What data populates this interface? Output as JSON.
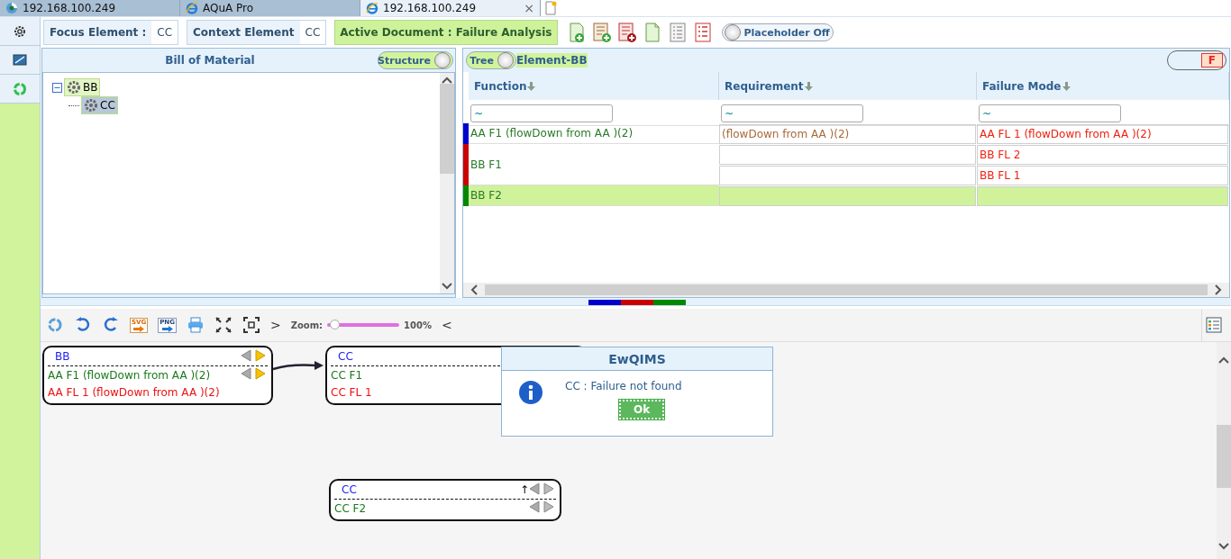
{
  "browser_tabs": [
    {
      "label": "192.168.100.249",
      "kind": "app",
      "selected": false
    },
    {
      "label": "AQuA Pro",
      "kind": "ie",
      "selected": false
    },
    {
      "label": "192.168.100.249",
      "kind": "ie",
      "selected": true,
      "close": "×"
    }
  ],
  "toolbar": {
    "focus_element": {
      "label": "Focus Element :",
      "value": "CC"
    },
    "context_element": {
      "label": "Context Element",
      "value": "CC"
    },
    "active_document": "Active Document : Failure Analysis",
    "placeholder_toggle": {
      "label": "Placeholder Off",
      "on": false
    }
  },
  "bom_panel": {
    "title": "Bill of Material",
    "structure_toggle": {
      "label": "Structure",
      "on": true
    },
    "tree": [
      {
        "label": "BB",
        "expanded": true,
        "selected": false,
        "children": [
          {
            "label": "CC",
            "selected": true
          }
        ]
      }
    ]
  },
  "analysis_panel": {
    "tree_toggle": {
      "label": "Tree",
      "on": true
    },
    "element": "Element-BB",
    "f_toggle": {
      "label": "F",
      "on": true
    },
    "table": {
      "columns": [
        "Function",
        "Requirement",
        "Failure Mode"
      ],
      "filters": [
        "~",
        "~",
        "~"
      ],
      "rows": [
        {
          "function": "AA F1 (flowDown from AA )(2)",
          "color": "#0000cc",
          "selected": false,
          "lines": [
            {
              "requirement": "(flowDown from AA )(2)",
              "failure_mode": "AA FL 1 (flowDown from AA )(2)"
            }
          ]
        },
        {
          "function": "BB F1",
          "color": "#cc0000",
          "selected": false,
          "lines": [
            {
              "failure_mode": "BB FL 2"
            },
            {
              "failure_mode": "BB FL 1"
            }
          ]
        },
        {
          "function": "BB F2",
          "color": "#008800",
          "selected": true
        }
      ]
    }
  },
  "diagram_toolbar": {
    "svg_label": "SVG",
    "png_label": "PNG",
    "next": ">",
    "zoom_label": "Zoom:",
    "zoom": {
      "level": 0.1
    },
    "zoom_value": "100%",
    "prev": "<"
  },
  "diagram": {
    "nodes": [
      {
        "title": "BB",
        "nav_enabled": true,
        "up": false,
        "lines": [
          {
            "text": "AA F1 (flowDown from AA )(2)",
            "kind": "function",
            "nav_enabled": true
          },
          {
            "text": "AA FL 1 (flowDown from AA )(2)",
            "kind": "failure"
          }
        ]
      },
      {
        "title": "CC",
        "lines": [
          {
            "text": "CC F1",
            "kind": "function"
          },
          {
            "text": "CC FL 1",
            "kind": "failure"
          }
        ]
      },
      {
        "title": "CC",
        "nav_enabled": false,
        "up": true,
        "up_label": "↑",
        "lines": [
          {
            "text": "CC F2",
            "kind": "function",
            "nav_enabled": false
          }
        ]
      }
    ],
    "dialog": {
      "title": "EwQIMS",
      "message": "CC : Failure not found",
      "button": "Ok"
    }
  }
}
